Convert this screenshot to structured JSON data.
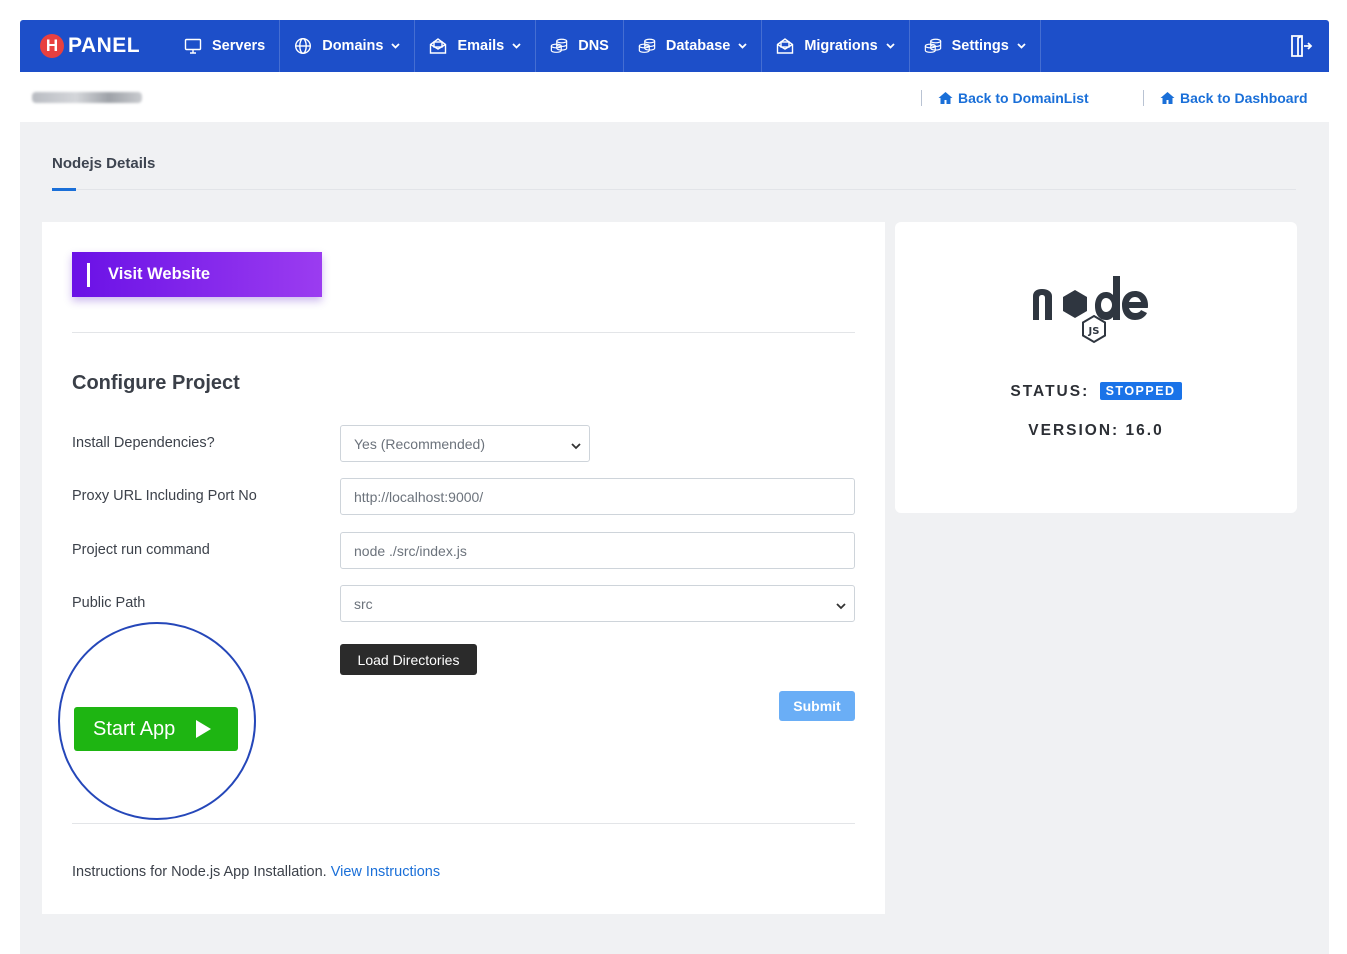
{
  "brand": {
    "letter": "H",
    "name": "PANEL"
  },
  "nav": [
    {
      "label": "Servers",
      "icon": "monitor-icon",
      "dropdown": false
    },
    {
      "label": "Domains",
      "icon": "globe-icon",
      "dropdown": true
    },
    {
      "label": "Emails",
      "icon": "envelope-icon",
      "dropdown": true
    },
    {
      "label": "DNS",
      "icon": "database-stack-icon",
      "dropdown": false
    },
    {
      "label": "Database",
      "icon": "database-stack-icon",
      "dropdown": true
    },
    {
      "label": "Migrations",
      "icon": "envelope-icon",
      "dropdown": true
    },
    {
      "label": "Settings",
      "icon": "database-stack-icon",
      "dropdown": true
    }
  ],
  "subbar": {
    "back_domain": "Back to DomainList",
    "back_dashboard": "Back to Dashboard"
  },
  "tab": {
    "title": "Nodejs Details"
  },
  "left": {
    "visit_label": "Visit Website",
    "config_title": "Configure Project",
    "fields": {
      "install": {
        "label": "Install Dependencies?",
        "value": "Yes (Recommended)"
      },
      "proxy": {
        "label": "Proxy URL Including Port No",
        "value": "http://localhost:9000/"
      },
      "runcmd": {
        "label": "Project run command",
        "value": "node ./src/index.js"
      },
      "public": {
        "label": "Public Path",
        "value": "src"
      }
    },
    "load_label": "Load Directories",
    "submit_label": "Submit",
    "start_label": "Start App",
    "instructions_text": "Instructions for Node.js App Installation.",
    "instructions_link": "View Instructions"
  },
  "right": {
    "status_label": "STATUS:",
    "status_value": "STOPPED",
    "version_label": "VERSION:",
    "version_value": "16.0"
  },
  "colors": {
    "nav_bg": "#1d4fc9",
    "link": "#1a6fd8",
    "start": "#1eb512",
    "status_badge": "#1a73e8",
    "visit_gradient_start": "#6a11e6",
    "visit_gradient_end": "#9b3cf0"
  }
}
